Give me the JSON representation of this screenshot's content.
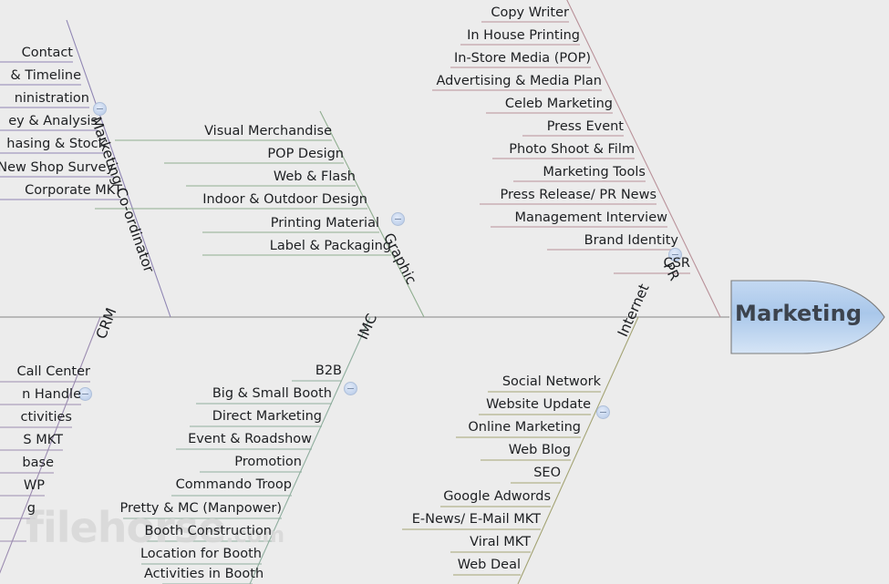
{
  "diagram": {
    "type": "fishbone-ishikawa",
    "head": {
      "label": "Marketing",
      "color": "#9dc0e8"
    },
    "background": "#ececec",
    "watermark": {
      "main": "filehorse",
      "suffix": ".com"
    },
    "spine": {
      "color": "#9a9a9a"
    }
  },
  "branches": [
    {
      "id": "marketing-coordinator",
      "label": "Marketing Co-ordinator",
      "position": "top-left",
      "color": "#8f85b3",
      "collapsed": false,
      "items": [
        "Contact",
        "& Timeline",
        "ninistration",
        "ey & Analysis",
        "hasing & Stock",
        "New Shop Survey",
        "Corporate MKT"
      ]
    },
    {
      "id": "graphic",
      "label": "Graphic",
      "position": "top-middle",
      "color": "#8fae8f",
      "collapsed": false,
      "items": [
        "Visual Merchandise",
        "POP Design",
        "Web & Flash",
        "Indoor & Outdoor Design",
        "Printing Material",
        "Label & Packaging"
      ]
    },
    {
      "id": "pr",
      "label": "PR",
      "position": "top-right",
      "color": "#b99199",
      "collapsed": false,
      "items": [
        "Copy Writer",
        "In House Printing",
        "In-Store Media (POP)",
        "Advertising & Media Plan",
        "Celeb Marketing",
        "Press Event",
        "Photo Shoot & Film",
        "Marketing Tools",
        "Press Release/ PR News",
        "Management Interview",
        "Brand Identity",
        "CSR"
      ]
    },
    {
      "id": "crm",
      "label": "CRM",
      "position": "bottom-left",
      "color": "#9b8bb0",
      "collapsed": false,
      "items": [
        "Call Center",
        "n Handle",
        "ctivities",
        "S MKT",
        "base",
        "WP",
        "g"
      ]
    },
    {
      "id": "imc",
      "label": "IMC",
      "position": "bottom-middle",
      "color": "#8fae9e",
      "collapsed": false,
      "items": [
        "B2B",
        "Big & Small Booth",
        "Direct Marketing",
        "Event & Roadshow",
        "Promotion",
        "Commando Troop",
        "Pretty & MC (Manpower)",
        "Booth Construction",
        "Location for Booth",
        "Activities in Booth"
      ]
    },
    {
      "id": "internet",
      "label": "Internet",
      "position": "bottom-right",
      "color": "#a3a373",
      "collapsed": false,
      "items": [
        "Social Network",
        "Website Update",
        "Online Marketing",
        "Web Blog",
        "SEO",
        "Google Adwords",
        "E-News/ E-Mail MKT",
        "Viral MKT",
        "Web Deal"
      ]
    }
  ]
}
